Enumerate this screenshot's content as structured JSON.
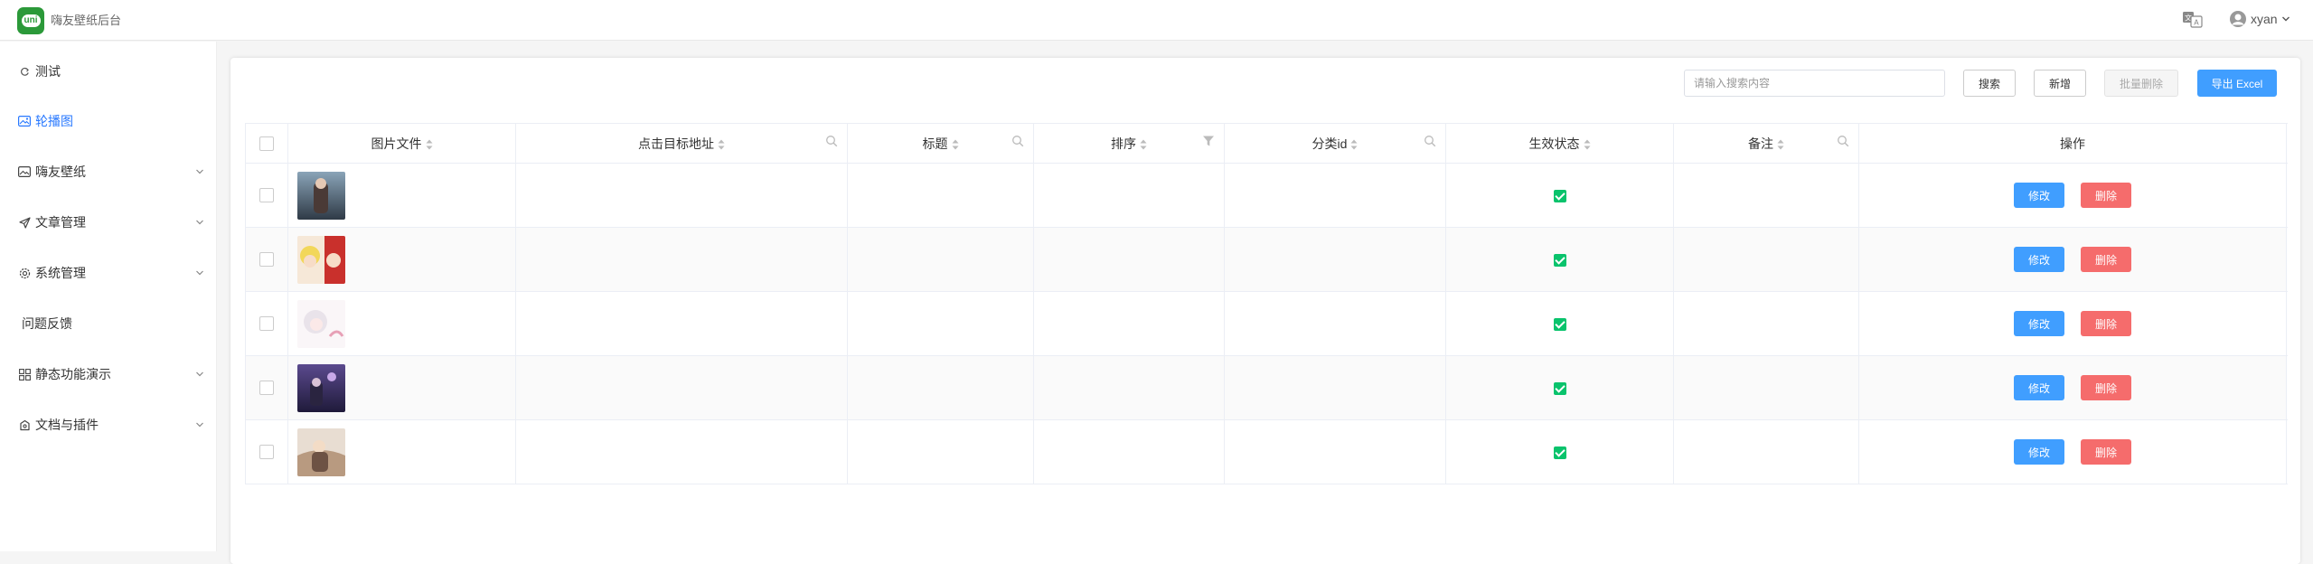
{
  "header": {
    "logo_text": "uni",
    "app_title": "嗨友壁纸后台",
    "username": "xyan"
  },
  "sidebar": {
    "items": [
      {
        "label": "测试",
        "icon": "refresh-icon",
        "expandable": false,
        "active": false
      },
      {
        "label": "轮播图",
        "icon": "image-icon",
        "expandable": false,
        "active": true
      },
      {
        "label": "嗨友壁纸",
        "icon": "picture-icon",
        "expandable": true,
        "active": false
      },
      {
        "label": "文章管理",
        "icon": "send-icon",
        "expandable": true,
        "active": false
      },
      {
        "label": "系统管理",
        "icon": "gear-icon",
        "expandable": true,
        "active": false
      },
      {
        "label": "问题反馈",
        "icon": "",
        "expandable": false,
        "active": false
      },
      {
        "label": "静态功能演示",
        "icon": "grid-icon",
        "expandable": true,
        "active": false
      },
      {
        "label": "文档与插件",
        "icon": "plugin-icon",
        "expandable": true,
        "active": false
      }
    ]
  },
  "toolbar": {
    "search_placeholder": "请输入搜索内容",
    "search_label": "搜索",
    "add_label": "新增",
    "batch_delete_label": "批量删除",
    "export_label": "导出 Excel"
  },
  "table": {
    "columns": [
      "图片文件",
      "点击目标地址",
      "标题",
      "排序",
      "分类id",
      "生效状态",
      "备注",
      "操作"
    ],
    "edit_label": "修改",
    "delete_label": "删除",
    "rows": [
      {
        "status": true
      },
      {
        "status": true
      },
      {
        "status": true
      },
      {
        "status": true
      },
      {
        "status": true
      }
    ]
  },
  "colors": {
    "primary": "#409eff",
    "danger": "#f56c6c",
    "success": "#09c36c",
    "active_menu": "#2979ff",
    "logo": "#2b9939"
  }
}
